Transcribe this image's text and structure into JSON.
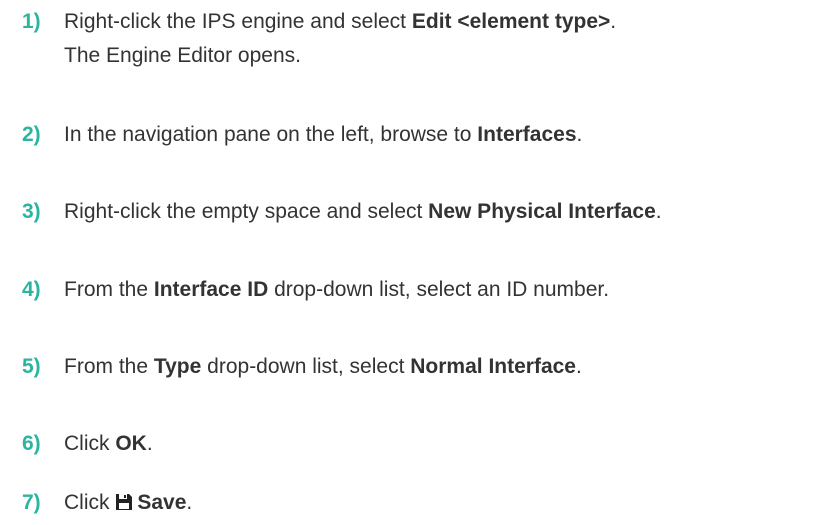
{
  "accent_color": "#2bb5a0",
  "steps": [
    {
      "number": "1)",
      "before": "Right-click the IPS engine and select ",
      "bold": "Edit <element type>",
      "after": ".",
      "result": "The Engine Editor opens."
    },
    {
      "number": "2)",
      "before": "In the navigation pane on the left, browse to ",
      "bold": "Interfaces",
      "after": "."
    },
    {
      "number": "3)",
      "before": "Right-click the empty space and select ",
      "bold": "New Physical Interface",
      "after": "."
    },
    {
      "number": "4)",
      "before": "From the ",
      "bold": "Interface ID",
      "after": " drop-down list, select an ID number."
    },
    {
      "number": "5)",
      "before": "From the ",
      "bold": "Type",
      "middle": " drop-down list, select ",
      "bold2": "Normal Interface",
      "after": "."
    },
    {
      "number": "6)",
      "before": "Click ",
      "bold": "OK",
      "after": "."
    },
    {
      "number": "7)",
      "before": "Click ",
      "icon": "save-icon",
      "bold": "Save",
      "after": "."
    }
  ]
}
